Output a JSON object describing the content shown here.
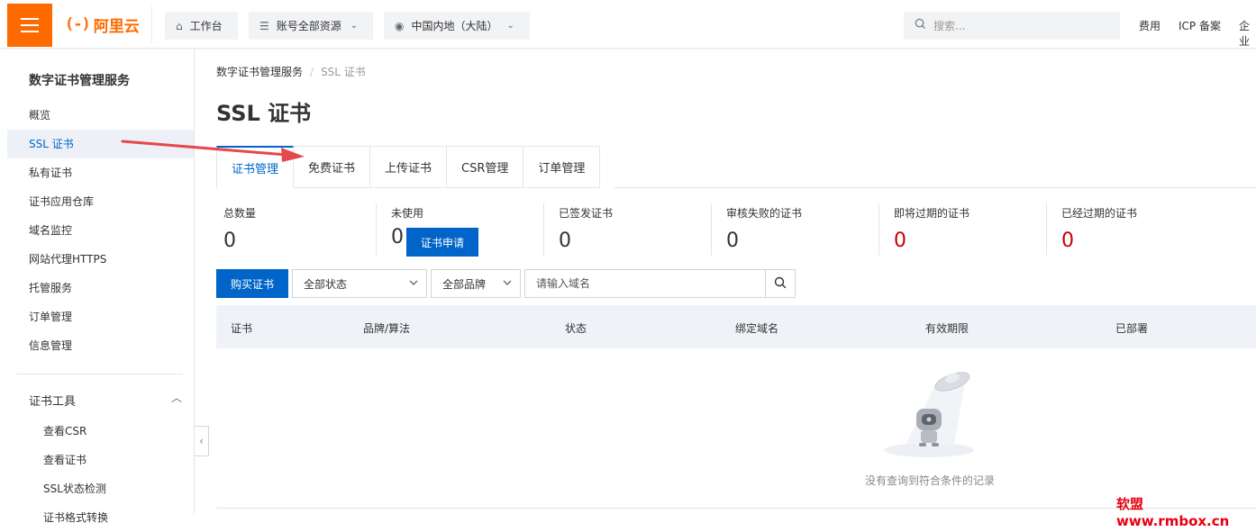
{
  "topbar": {
    "logo_mark": "(-)",
    "logo_text": "阿里云",
    "nav": [
      {
        "label": "工作台",
        "icon": "home-icon"
      },
      {
        "label": "账号全部资源",
        "icon": "stack-icon"
      },
      {
        "label": "中国内地（大陆）",
        "icon": "location-icon"
      }
    ],
    "search_placeholder": "搜索...",
    "links": [
      "费用",
      "ICP 备案",
      "企业"
    ]
  },
  "sidebar": {
    "title": "数字证书管理服务",
    "items": [
      "概览",
      "SSL 证书",
      "私有证书",
      "证书应用仓库",
      "域名监控",
      "网站代理HTTPS",
      "托管服务",
      "订单管理",
      "信息管理"
    ],
    "active_index": 1,
    "group": "证书工具",
    "sub_items": [
      "查看CSR",
      "查看证书",
      "SSL状态检测",
      "证书格式转换"
    ]
  },
  "breadcrumb": {
    "root": "数字证书管理服务",
    "current": "SSL 证书"
  },
  "page_title": "SSL 证书",
  "tabs": [
    "证书管理",
    "免费证书",
    "上传证书",
    "CSR管理",
    "订单管理"
  ],
  "active_tab": 0,
  "stats": [
    {
      "label": "总数量",
      "value": "0"
    },
    {
      "label": "未使用",
      "value": "0"
    },
    {
      "label": "已签发证书",
      "value": "0"
    },
    {
      "label": "审核失败的证书",
      "value": "0"
    },
    {
      "label": "即将过期的证书",
      "value": "0",
      "color": "#c80000"
    },
    {
      "label": "已经过期的证书",
      "value": "0",
      "color": "#c80000"
    }
  ],
  "apply_button": "证书申请",
  "toolbar": {
    "buy_button": "购买证书",
    "status_select": "全部状态",
    "brand_select": "全部品牌",
    "domain_placeholder": "请输入域名"
  },
  "table": {
    "columns": [
      "证书",
      "品牌/算法",
      "状态",
      "绑定域名",
      "有效期限",
      "已部署"
    ],
    "empty_text": "没有查询到符合条件的记录"
  },
  "watermark": "软盟www.rmbox.cn",
  "colors": {
    "brand": "#ff6a00",
    "primary": "#0064c8",
    "danger": "#c80000"
  }
}
